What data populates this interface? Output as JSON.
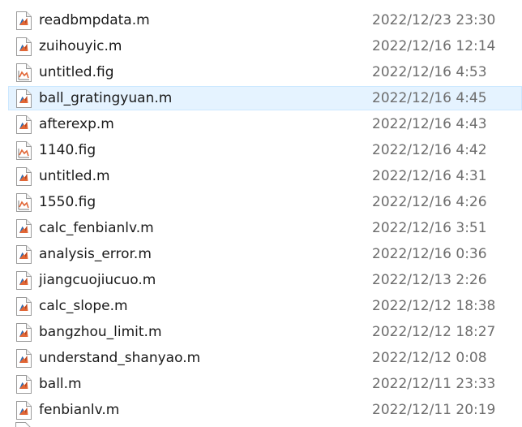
{
  "files": [
    {
      "name": "readbmpdata.m",
      "modified": "2022/12/23 23:30",
      "type": "m",
      "icon": "matlab-script-icon"
    },
    {
      "name": "zuihouyic.m",
      "modified": "2022/12/16 12:14",
      "type": "m",
      "icon": "matlab-script-icon"
    },
    {
      "name": "untitled.fig",
      "modified": "2022/12/16 4:53",
      "type": "fig",
      "icon": "matlab-figure-icon"
    },
    {
      "name": "ball_gratingyuan.m",
      "modified": "2022/12/16 4:45",
      "type": "m",
      "icon": "matlab-script-icon",
      "selected": true
    },
    {
      "name": "afterexp.m",
      "modified": "2022/12/16 4:43",
      "type": "m",
      "icon": "matlab-script-icon"
    },
    {
      "name": "1140.fig",
      "modified": "2022/12/16 4:42",
      "type": "fig",
      "icon": "matlab-figure-icon"
    },
    {
      "name": "untitled.m",
      "modified": "2022/12/16 4:31",
      "type": "m",
      "icon": "matlab-script-icon"
    },
    {
      "name": "1550.fig",
      "modified": "2022/12/16 4:26",
      "type": "fig",
      "icon": "matlab-figure-icon"
    },
    {
      "name": "calc_fenbianlv.m",
      "modified": "2022/12/16 3:51",
      "type": "m",
      "icon": "matlab-script-icon"
    },
    {
      "name": "analysis_error.m",
      "modified": "2022/12/16 0:36",
      "type": "m",
      "icon": "matlab-script-icon"
    },
    {
      "name": "jiangcuojiucuo.m",
      "modified": "2022/12/13 2:26",
      "type": "m",
      "icon": "matlab-script-icon"
    },
    {
      "name": "calc_slope.m",
      "modified": "2022/12/12 18:38",
      "type": "m",
      "icon": "matlab-script-icon"
    },
    {
      "name": "bangzhou_limit.m",
      "modified": "2022/12/12 18:27",
      "type": "m",
      "icon": "matlab-script-icon"
    },
    {
      "name": "understand_shanyao.m",
      "modified": "2022/12/12 0:08",
      "type": "m",
      "icon": "matlab-script-icon"
    },
    {
      "name": "ball.m",
      "modified": "2022/12/11 23:33",
      "type": "m",
      "icon": "matlab-script-icon"
    },
    {
      "name": "fenbianlv.m",
      "modified": "2022/12/11 20:19",
      "type": "m",
      "icon": "matlab-script-icon"
    }
  ],
  "colors": {
    "selected_bg": "#e5f3ff",
    "selected_border": "#cce8ff",
    "name_text": "#1a1a1a",
    "date_text": "#6d6d6d",
    "matlab_orange": "#e16737",
    "matlab_blue": "#1f6fbf"
  }
}
